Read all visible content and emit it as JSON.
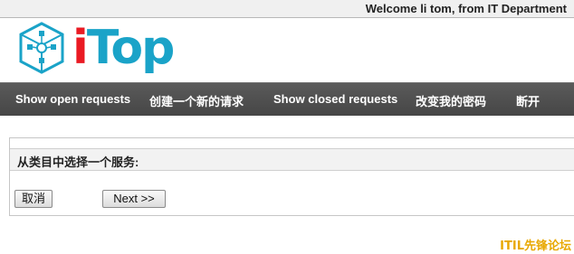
{
  "header": {
    "welcome_text": "Welcome li tom, from IT Department",
    "logo": {
      "text_i": "i",
      "text_rest": "Top",
      "icon": "itop-cube-icon",
      "colors": {
        "primary": "#1aa3c8",
        "accent": "#ea1a23"
      }
    }
  },
  "nav": {
    "items": [
      {
        "label": "Show open requests"
      },
      {
        "label": "创建一个新的请求"
      },
      {
        "label": "Show closed requests"
      },
      {
        "label": "改变我的密码"
      },
      {
        "label": "断开"
      }
    ]
  },
  "form": {
    "title": "从类目中选择一个服务:",
    "cancel_label": "取消",
    "next_label": "Next >>"
  },
  "watermark": "ITIL先锋论坛"
}
